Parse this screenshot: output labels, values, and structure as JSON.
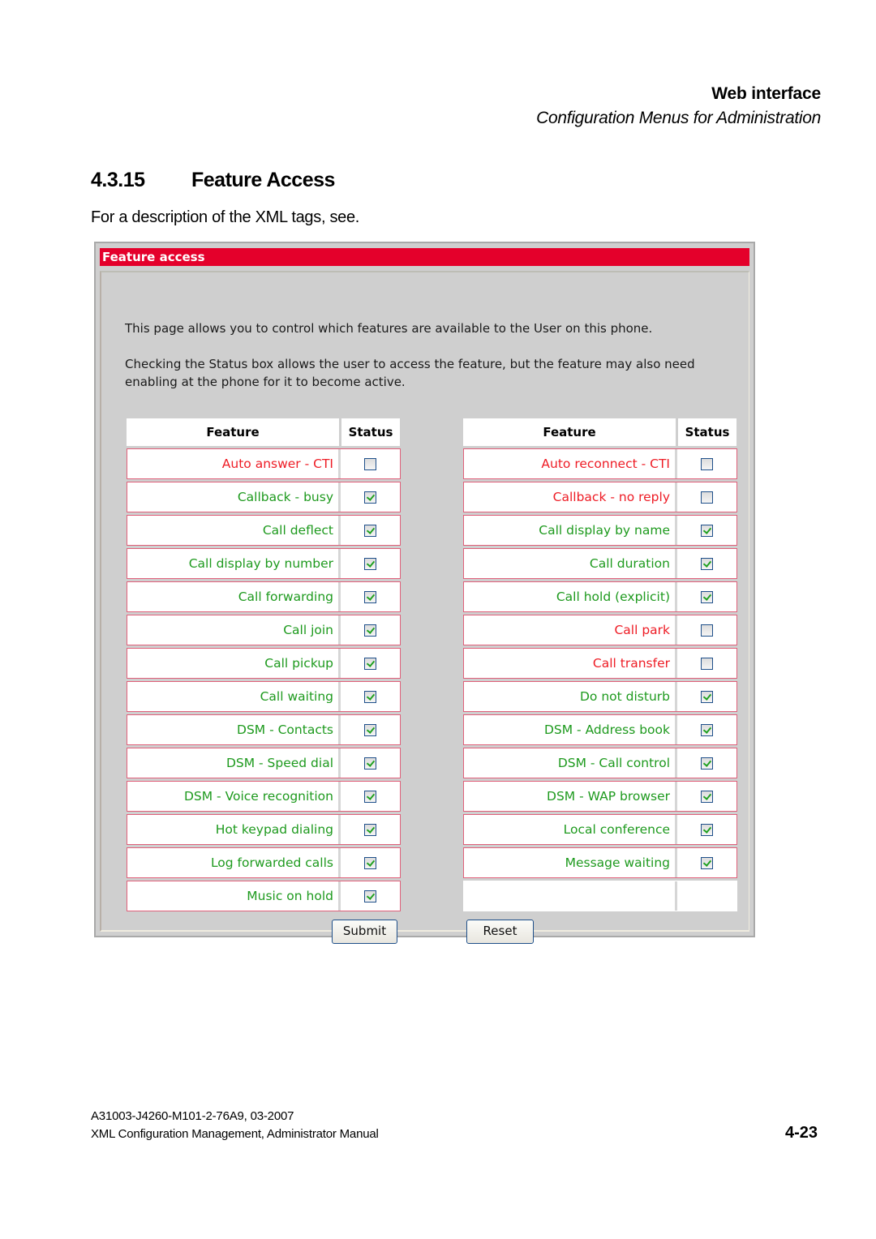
{
  "header": {
    "title": "Web interface",
    "subtitle": "Configuration Menus for Administration"
  },
  "section": {
    "number": "4.3.15",
    "title": "Feature Access",
    "intro": "For a description of the XML tags, see."
  },
  "panel": {
    "title": "Feature access",
    "description_1": "This page allows you to control which features are available to the User on this phone.",
    "description_2": "Checking the Status box allows the user to access the feature, but the feature may also need enabling at the phone for it to become active.",
    "column_feature": "Feature",
    "column_status": "Status",
    "left_features": [
      {
        "label": "Auto answer - CTI",
        "checked": false
      },
      {
        "label": "Callback - busy",
        "checked": true
      },
      {
        "label": "Call deflect",
        "checked": true
      },
      {
        "label": "Call display by number",
        "checked": true
      },
      {
        "label": "Call forwarding",
        "checked": true
      },
      {
        "label": "Call join",
        "checked": true
      },
      {
        "label": "Call pickup",
        "checked": true
      },
      {
        "label": "Call waiting",
        "checked": true
      },
      {
        "label": "DSM - Contacts",
        "checked": true
      },
      {
        "label": "DSM - Speed dial",
        "checked": true
      },
      {
        "label": "DSM - Voice recognition",
        "checked": true
      },
      {
        "label": "Hot keypad dialing",
        "checked": true
      },
      {
        "label": "Log forwarded calls",
        "checked": true
      },
      {
        "label": "Music on hold",
        "checked": true
      }
    ],
    "right_features": [
      {
        "label": "Auto reconnect - CTI",
        "checked": false
      },
      {
        "label": "Callback - no reply",
        "checked": false
      },
      {
        "label": "Call display by name",
        "checked": true
      },
      {
        "label": "Call duration",
        "checked": true
      },
      {
        "label": "Call hold (explicit)",
        "checked": true
      },
      {
        "label": "Call park",
        "checked": false
      },
      {
        "label": "Call transfer",
        "checked": false
      },
      {
        "label": "Do not disturb",
        "checked": true
      },
      {
        "label": "DSM - Address book",
        "checked": true
      },
      {
        "label": "DSM - Call control",
        "checked": true
      },
      {
        "label": "DSM - WAP browser",
        "checked": true
      },
      {
        "label": "Local conference",
        "checked": true
      },
      {
        "label": "Message waiting",
        "checked": true
      }
    ],
    "submit_label": "Submit",
    "reset_label": "Reset",
    "colors": {
      "title_bar": "#e4002b",
      "enabled_text": "#1e9a1e",
      "disabled_text": "#ee1c25"
    }
  },
  "footer": {
    "doc_id": "A31003-J4260-M101-2-76A9, 03-2007",
    "doc_title": "XML Configuration Management, Administrator Manual",
    "page_number": "4-23"
  }
}
